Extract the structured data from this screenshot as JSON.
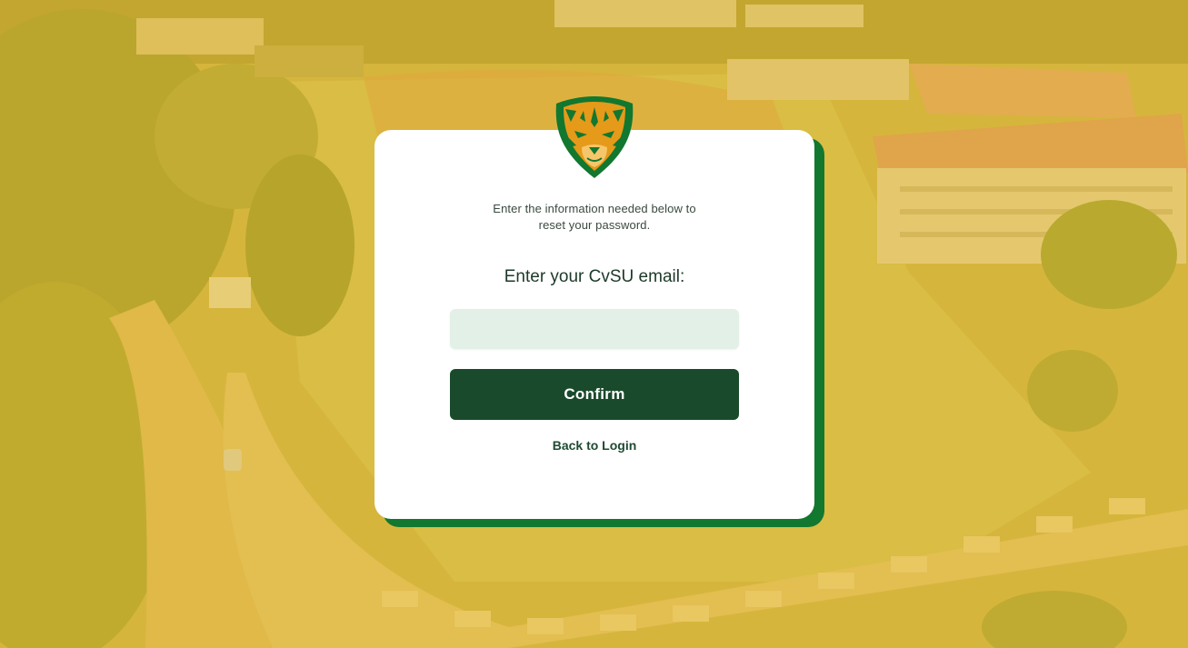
{
  "background": {
    "description_icon": "campus-aerial-photo",
    "overlay_color": "#ecba28"
  },
  "logo": {
    "icon": "tiger-head-icon",
    "colors": {
      "green": "#12772f",
      "orange": "#e59a1a"
    }
  },
  "reset_card": {
    "instruction_line1": "Enter the information needed below to",
    "instruction_line2": "reset your password.",
    "email_label": "Enter your CvSU email:",
    "email_value": "",
    "email_placeholder": "",
    "confirm_label": "Confirm",
    "back_label": "Back to Login"
  },
  "colors": {
    "card_accent": "#12772f",
    "button": "#1a4a2c",
    "input_bg": "#e3f0e7"
  }
}
